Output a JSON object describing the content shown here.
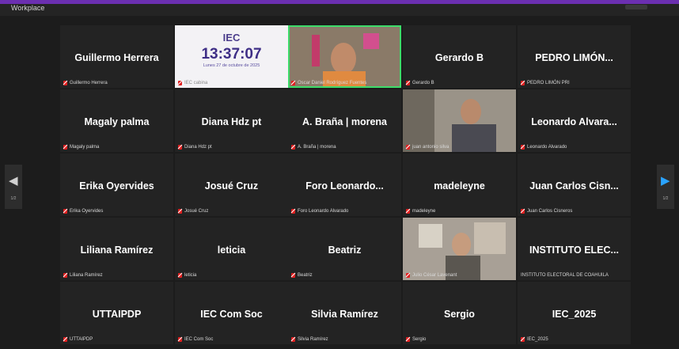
{
  "window": {
    "title": "Workplace"
  },
  "pager": {
    "left": "1/2",
    "right": "1/2"
  },
  "iec_card": {
    "logo": "IEC",
    "time": "13:37:07",
    "date": "Lunes 27 de octubre de 2025",
    "caption": "IEC cabina"
  },
  "tiles": [
    {
      "name": "Guillermo Herrera",
      "caption": "Guillermo Herrera"
    },
    {
      "name": "",
      "caption": "Oscar Daniel Rodríguez Fuentes"
    },
    {
      "name": "Gerardo B",
      "caption": "Gerardo B"
    },
    {
      "name": "PEDRO LIMÓN...",
      "caption": "PEDRO LIMÓN PRI"
    },
    {
      "name": "Magaly palma",
      "caption": "Magaly palma"
    },
    {
      "name": "Diana Hdz pt",
      "caption": "Diana Hdz pt"
    },
    {
      "name": "A. Braña | morena",
      "caption": "A. Braña | morena"
    },
    {
      "name": "",
      "caption": "juan antonio silva"
    },
    {
      "name": "Leonardo Alvara...",
      "caption": "Leonardo Alvarado"
    },
    {
      "name": "Erika Oyervides",
      "caption": "Erika Oyervides"
    },
    {
      "name": "Josué Cruz",
      "caption": "Josué Cruz"
    },
    {
      "name": "Foro Leonardo...",
      "caption": "Foro Leonardo Alvarado"
    },
    {
      "name": "madeleyne",
      "caption": "madeleyne"
    },
    {
      "name": "Juan Carlos Cisn...",
      "caption": "Juan Carlos Cisneros"
    },
    {
      "name": "Liliana Ramírez",
      "caption": "Liliana Ramírez"
    },
    {
      "name": "leticia",
      "caption": "leticia"
    },
    {
      "name": "Beatriz",
      "caption": "Beatriz"
    },
    {
      "name": "",
      "caption": "Julio César Lavenant"
    },
    {
      "name": "INSTITUTO ELEC...",
      "caption": "INSTITUTO ELECTORAL DE COAHUILA"
    },
    {
      "name": "UTTAIPDP",
      "caption": "UTTAIPDP"
    },
    {
      "name": "IEC Com Soc",
      "caption": "IEC Com Soc"
    },
    {
      "name": "Silvia Ramírez",
      "caption": "Silvia Ramírez"
    },
    {
      "name": "Sergio",
      "caption": "Sergio"
    },
    {
      "name": "IEC_2025",
      "caption": "IEC_2025"
    }
  ]
}
